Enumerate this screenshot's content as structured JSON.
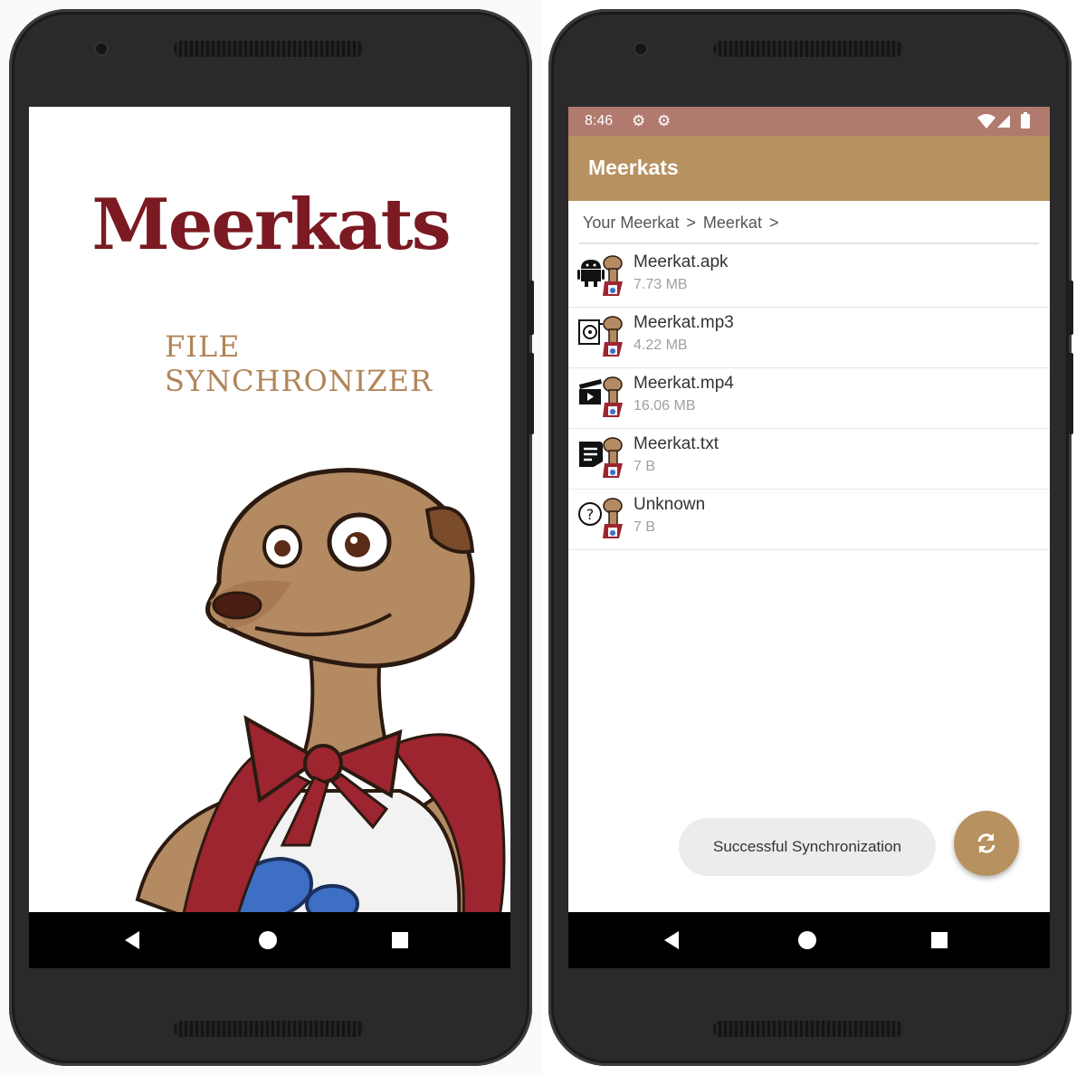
{
  "splash": {
    "title": "Meerkats",
    "subtitle": "FILE SYNCHRONIZER"
  },
  "status_bar": {
    "time": "8:46",
    "icons": [
      "gear-icon",
      "gear-icon",
      "wifi-icon",
      "signal-icon",
      "battery-icon"
    ]
  },
  "app_bar": {
    "title": "Meerkats"
  },
  "breadcrumb": [
    {
      "label": "Your Meerkat",
      "sep": ">"
    },
    {
      "label": "Meerkat",
      "sep": ">"
    }
  ],
  "files": [
    {
      "name": "Meerkat.apk",
      "size": "7.73 MB",
      "icon": "android-icon"
    },
    {
      "name": "Meerkat.mp3",
      "size": "4.22 MB",
      "icon": "audio-file-icon"
    },
    {
      "name": "Meerkat.mp4",
      "size": "16.06 MB",
      "icon": "video-clapper-icon"
    },
    {
      "name": "Meerkat.txt",
      "size": "7 B",
      "icon": "text-doc-icon"
    },
    {
      "name": "Unknown",
      "size": "7 B",
      "icon": "question-icon"
    }
  ],
  "toast": {
    "message": "Successful Synchronization"
  },
  "fab": {
    "icon": "sync-icon"
  },
  "colors": {
    "status_bar": "#b07a6e",
    "app_bar": "#b7915f",
    "fab": "#b7915f",
    "logo_red": "#7b1a22",
    "logo_tan": "#b08458"
  }
}
